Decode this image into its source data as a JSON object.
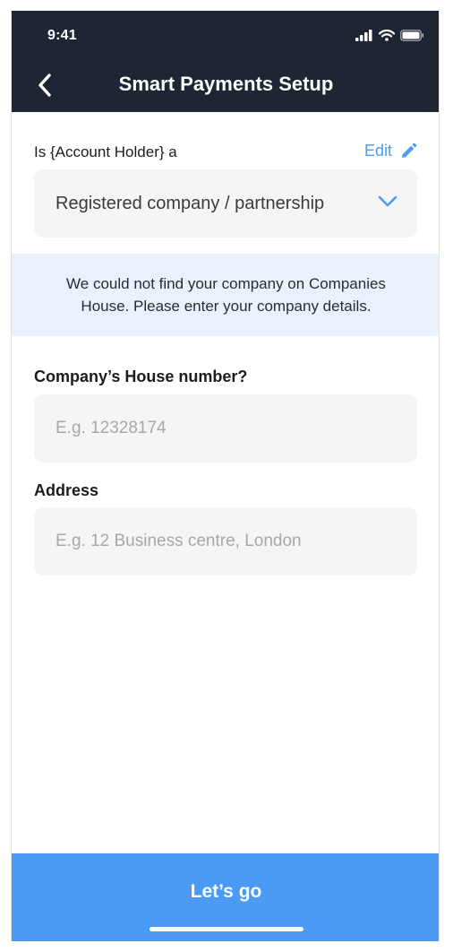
{
  "status_bar": {
    "time": "9:41"
  },
  "header": {
    "title": "Smart Payments Setup"
  },
  "account_type": {
    "question": "Is {Account Holder} a",
    "edit_label": "Edit",
    "selected_value": "Registered company / partnership"
  },
  "info_banner": {
    "line1": "We could not find your company on Companies",
    "line2": "House. Please enter your company details."
  },
  "company_number": {
    "label": "Company’s House number?",
    "placeholder": "E.g. 12328174"
  },
  "address": {
    "label": "Address",
    "placeholder": "E.g. 12 Business centre, London"
  },
  "cta": {
    "label": "Let’s go"
  },
  "colors": {
    "header_bg": "#1f2633",
    "accent": "#4b9af4",
    "banner_bg": "#e8f1fc",
    "field_bg": "#f5f5f5"
  },
  "icons": [
    "signal-icon",
    "wifi-icon",
    "battery-icon",
    "back-chevron-icon",
    "pencil-icon",
    "chevron-down-icon"
  ]
}
